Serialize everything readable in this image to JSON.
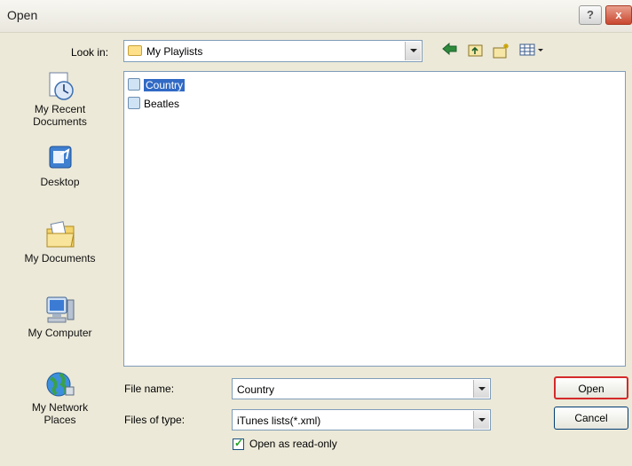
{
  "window": {
    "title": "Open",
    "help_glyph": "?",
    "close_glyph": "x"
  },
  "lookin": {
    "label": "Look in:",
    "value": "My Playlists"
  },
  "places": [
    {
      "label_line1": "My Recent",
      "label_line2": "Documents",
      "icon": "recent-documents-icon"
    },
    {
      "label_line1": "Desktop",
      "label_line2": "",
      "icon": "desktop-icon"
    },
    {
      "label_line1": "My Documents",
      "label_line2": "",
      "icon": "my-documents-icon"
    },
    {
      "label_line1": "My Computer",
      "label_line2": "",
      "icon": "my-computer-icon"
    },
    {
      "label_line1": "My Network",
      "label_line2": "Places",
      "icon": "network-places-icon"
    }
  ],
  "files": [
    {
      "name": "Country",
      "selected": true
    },
    {
      "name": "Beatles",
      "selected": false
    }
  ],
  "filename": {
    "label": "File name:",
    "value": "Country"
  },
  "filetype": {
    "label": "Files of type:",
    "value": "iTunes lists(*.xml)"
  },
  "readonly": {
    "label": "Open as read-only",
    "checked": true
  },
  "buttons": {
    "open": "Open",
    "cancel": "Cancel"
  },
  "colors": {
    "selection": "#316ac5",
    "highlight_border": "#d42a2a",
    "dialog_bg": "#ece9d8"
  }
}
